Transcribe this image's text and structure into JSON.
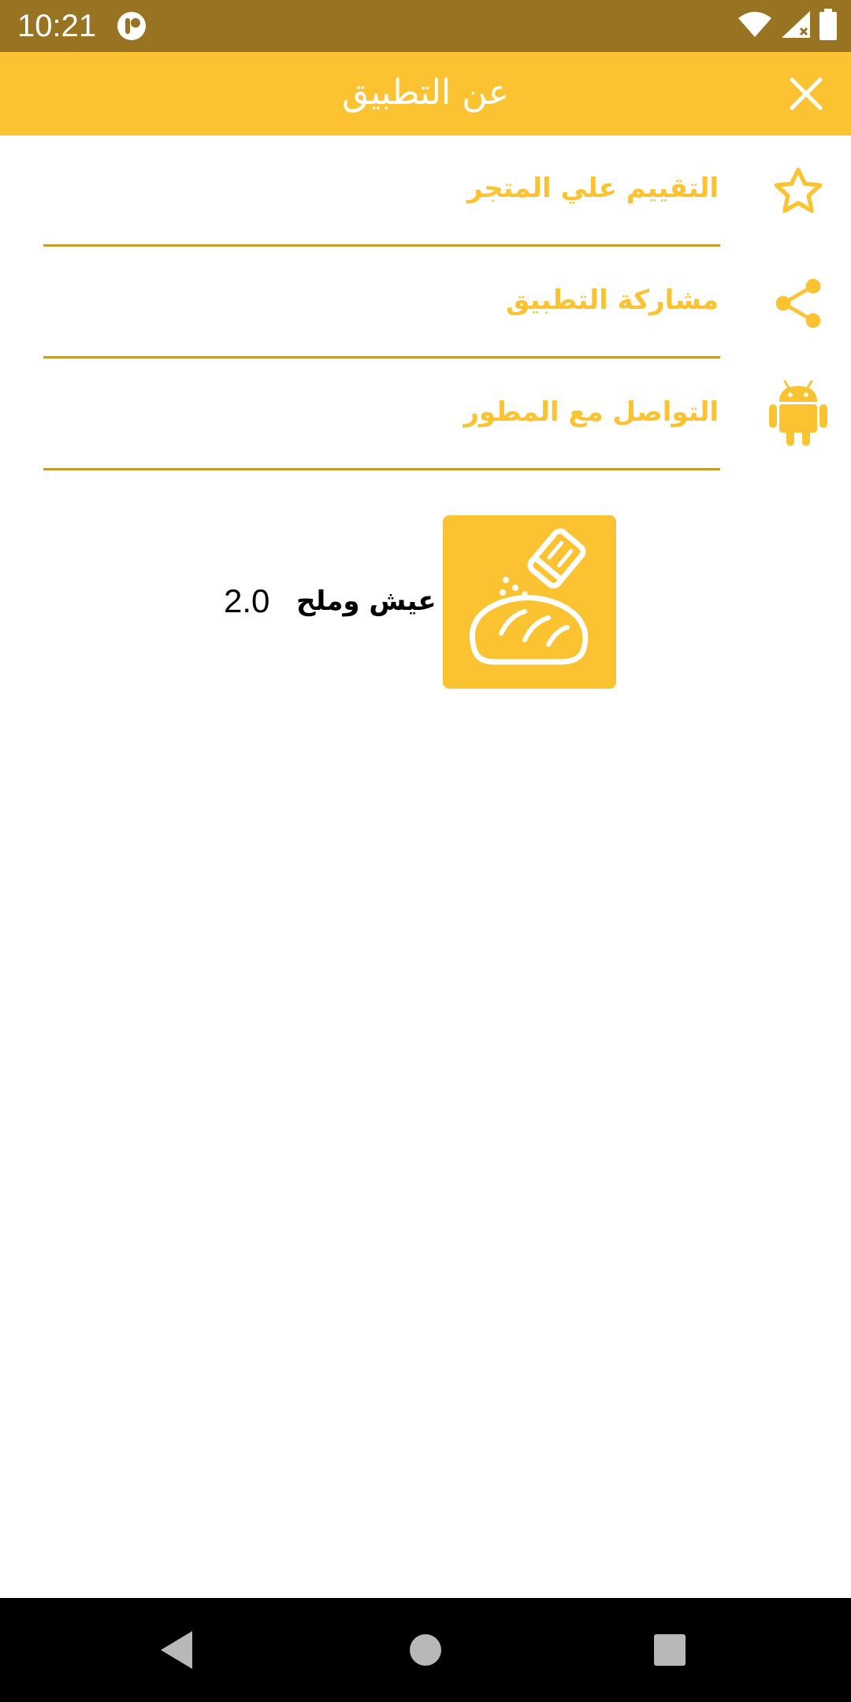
{
  "status_bar": {
    "time": "10:21",
    "background": "#987321"
  },
  "app_bar": {
    "title": "عن التطبيق",
    "background": "#fbc231",
    "close_icon": "close-icon"
  },
  "menu": {
    "accent": "#fbc231",
    "divider_color": "#c89a28",
    "items": [
      {
        "label": "التقييم علي المتجر",
        "icon": "star-outline-icon"
      },
      {
        "label": "مشاركة التطبيق",
        "icon": "share-icon"
      },
      {
        "label": "التواصل مع المطور",
        "icon": "android-icon"
      }
    ]
  },
  "app_info": {
    "name": "عيش وملح",
    "version": "2.0",
    "logo_icon": "bread-salt-shaker-icon"
  },
  "nav_bar": {
    "back_icon": "back-triangle-icon",
    "home_icon": "home-circle-icon",
    "recents_icon": "recents-square-icon"
  }
}
